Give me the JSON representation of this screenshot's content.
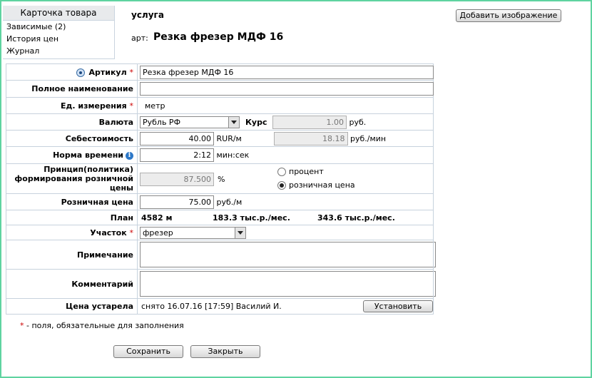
{
  "sidebar": {
    "title": "Карточка товара",
    "items": [
      "Зависимые (2)",
      "История цен",
      "Журнал"
    ]
  },
  "header": {
    "type": "услуга",
    "art_label": "арт:",
    "art_value": "Резка фрезер МДФ 16",
    "add_image_button": "Добавить изображение"
  },
  "form": {
    "article": {
      "label": "Артикул",
      "value": "Резка фрезер МДФ 16"
    },
    "full_name": {
      "label": "Полное наименование",
      "value": ""
    },
    "unit": {
      "label": "Ед. измерения",
      "value": "метр"
    },
    "currency": {
      "label": "Валюта",
      "value": "Рубль РФ",
      "rate_label": "Курс",
      "rate_value": "1.00",
      "rate_unit": "руб."
    },
    "cost": {
      "label": "Себестоимость",
      "value": "40.00",
      "unit": "RUR/м",
      "value2": "18.18",
      "unit2": "руб./мин"
    },
    "time_norm": {
      "label": "Норма времени",
      "value": "2:12",
      "unit": "мин:сек"
    },
    "policy": {
      "label": "Принцип(политика) формирования розничной цены",
      "value": "87.500",
      "unit": "%",
      "options": [
        {
          "label": "процент",
          "selected": false
        },
        {
          "label": "розничная цена",
          "selected": true
        }
      ]
    },
    "retail": {
      "label": "Розничная цена",
      "value": "75.00",
      "unit": "руб./м"
    },
    "plan": {
      "label": "План",
      "v1": "4582 м",
      "v2": "183.3 тыс.р./мес.",
      "v3": "343.6 тыс.р./мес."
    },
    "section": {
      "label": "Участок",
      "value": "фрезер"
    },
    "note": {
      "label": "Примечание",
      "value": ""
    },
    "comment": {
      "label": "Комментарий",
      "value": ""
    },
    "outdated": {
      "label": "Цена устарела",
      "value": "снято 16.07.16 [17:59] Василий И.",
      "button": "Установить"
    }
  },
  "required_mark": "*",
  "required_note": "- поля, обязательные для заполнения",
  "buttons": {
    "save": "Сохранить",
    "close": "Закрыть"
  }
}
